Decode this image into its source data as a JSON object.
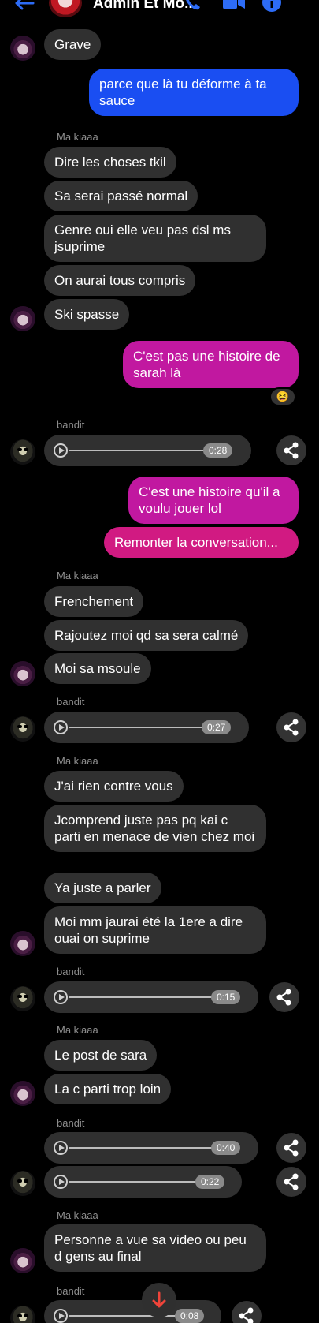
{
  "header": {
    "title": "Admin Et Mo..."
  },
  "colors": {
    "accent": "#1a4ef2",
    "outgoing_pink": "#c118a0",
    "incoming": "#303030"
  },
  "messages": {
    "m1": "Grave",
    "m2": "parce que là tu déforme à ta sauce",
    "s1": "Ma kiaaa",
    "m3": "Dire les choses tkil",
    "m4": "Sa serai passé normal",
    "m5": "Genre oui elle veu pas dsl ms jsuprime",
    "m6": "On aurai tous compris",
    "m7": "Ski spasse",
    "m8": "C'est pas une histoire de sarah là",
    "reaction1": "😆",
    "s2": "bandit",
    "a1": "0:28",
    "m9": "C'est une histoire qu'il a voulu jouer lol",
    "m10": "Remonter la conversation...",
    "s3": "Ma kiaaa",
    "m11": "Frenchement",
    "m12": "Rajoutez moi qd sa sera calmé",
    "m13": "Moi sa msoule",
    "s4": "bandit",
    "a2": "0:27",
    "s5": "Ma kiaaa",
    "m14": "J'ai rien contre vous",
    "m15": "Jcomprend juste pas pq kai c parti en menace de vien chez moi",
    "m16": "Ya juste a parler",
    "m17": "Moi mm jaurai été la 1ere a dire ouai on suprime",
    "s6": "bandit",
    "a3": "0:15",
    "s7": "Ma kiaaa",
    "m18": "Le post de sara",
    "m19": "La c parti trop loin",
    "s8": "bandit",
    "a4": "0:40",
    "a5": "0:22",
    "s9": "Ma kiaaa",
    "m20": "Personne a vue sa video ou peu d gens au final",
    "s10": "bandit",
    "a6": "0:08"
  }
}
